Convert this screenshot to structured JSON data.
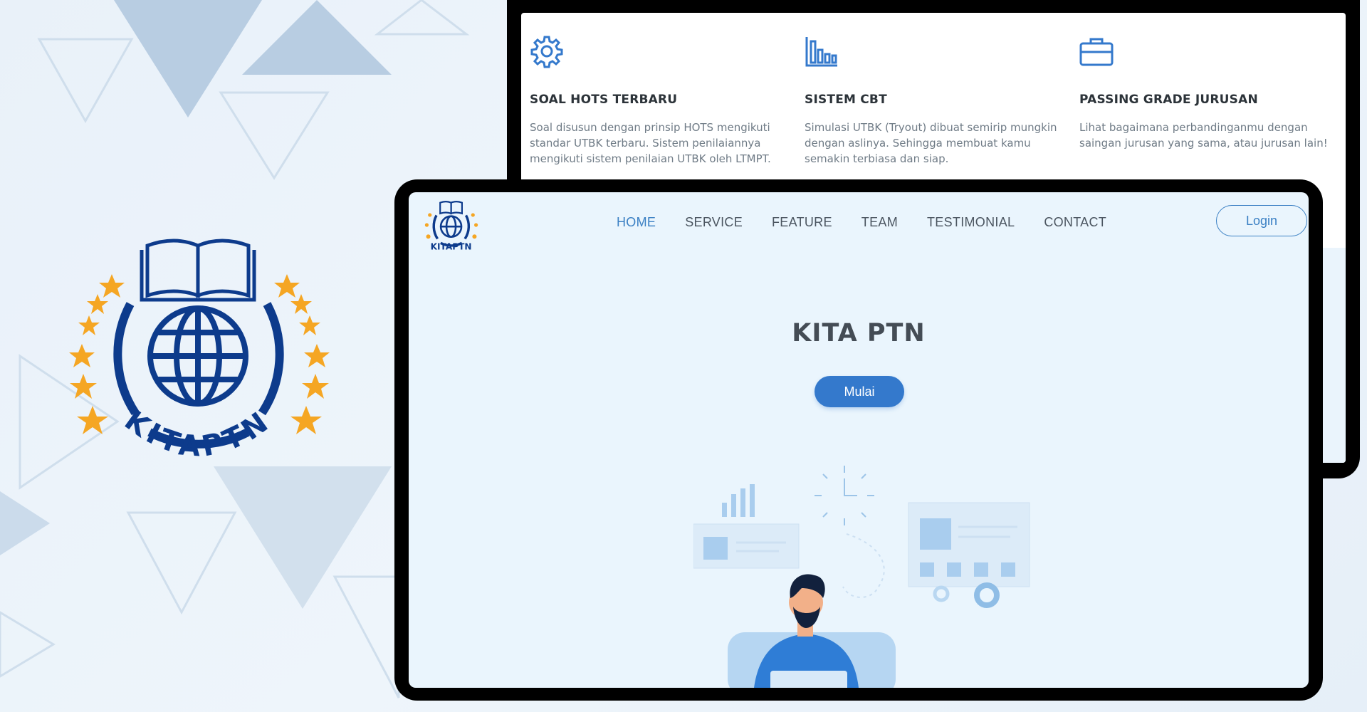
{
  "brand": {
    "logo_text": "KITAPTN",
    "colors": {
      "navy": "#0d3b8c",
      "star": "#f5a623",
      "accent": "#3479cc"
    }
  },
  "features": [
    {
      "icon": "gear-icon",
      "title": "SOAL HOTS TERBARU",
      "text": "Soal disusun dengan prinsip HOTS mengikuti standar UTBK terbaru. Sistem penilaiannya mengikuti sistem penilaian UTBK oleh LTMPT."
    },
    {
      "icon": "bar-chart-icon",
      "title": "SISTEM CBT",
      "text": "Simulasi UTBK (Tryout) dibuat semirip mungkin dengan aslinya. Sehingga membuat kamu semakin terbiasa dan siap."
    },
    {
      "icon": "briefcase-icon",
      "title": "PASSING GRADE JURUSAN",
      "text": "Lihat bagaimana perbandinganmu dengan saingan jurusan yang sama, atau jurusan lain!"
    }
  ],
  "nav": {
    "items": [
      "HOME",
      "SERVICE",
      "FEATURE",
      "TEAM",
      "TESTIMONIAL",
      "CONTACT"
    ],
    "active": "HOME",
    "login_label": "Login"
  },
  "hero": {
    "title": "KITA PTN",
    "button_label": "Mulai"
  }
}
